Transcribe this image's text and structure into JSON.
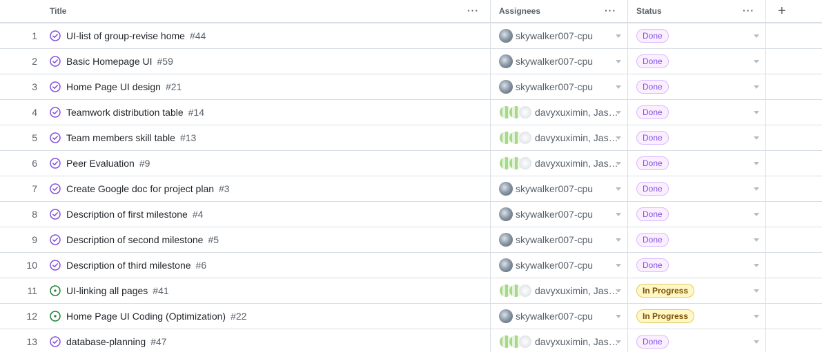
{
  "header": {
    "title": "Title",
    "assignees": "Assignees",
    "status": "Status",
    "menu_dots": "···",
    "add_column": "+"
  },
  "colors": {
    "done_accent": "#8250df",
    "open_accent": "#1a7f37",
    "progress_bg": "#fff8c5"
  },
  "rows": [
    {
      "num": "1",
      "title": "UI-list of group-revise home",
      "issue": "#44",
      "state": "done",
      "assignees": "skywalker007-cpu",
      "avatars": "single",
      "status": "Done"
    },
    {
      "num": "2",
      "title": "Basic Homepage UI",
      "issue": "#59",
      "state": "done",
      "assignees": "skywalker007-cpu",
      "avatars": "single",
      "status": "Done"
    },
    {
      "num": "3",
      "title": "Home Page UI design",
      "issue": "#21",
      "state": "done",
      "assignees": "skywalker007-cpu",
      "avatars": "single",
      "status": "Done"
    },
    {
      "num": "4",
      "title": "Teamwork distribution table",
      "issue": "#14",
      "state": "done",
      "assignees": "davyxuximin, Jases...",
      "avatars": "multi",
      "status": "Done"
    },
    {
      "num": "5",
      "title": "Team members skill table",
      "issue": "#13",
      "state": "done",
      "assignees": "davyxuximin, Jases...",
      "avatars": "multi",
      "status": "Done"
    },
    {
      "num": "6",
      "title": "Peer Evaluation",
      "issue": "#9",
      "state": "done",
      "assignees": "davyxuximin, Jases...",
      "avatars": "multi",
      "status": "Done"
    },
    {
      "num": "7",
      "title": "Create Google doc for project plan",
      "issue": "#3",
      "state": "done",
      "assignees": "skywalker007-cpu",
      "avatars": "single",
      "status": "Done"
    },
    {
      "num": "8",
      "title": "Description of first milestone",
      "issue": "#4",
      "state": "done",
      "assignees": "skywalker007-cpu",
      "avatars": "single",
      "status": "Done"
    },
    {
      "num": "9",
      "title": "Description of second milestone",
      "issue": "#5",
      "state": "done",
      "assignees": "skywalker007-cpu",
      "avatars": "single",
      "status": "Done"
    },
    {
      "num": "10",
      "title": "Description of third milestone",
      "issue": "#6",
      "state": "done",
      "assignees": "skywalker007-cpu",
      "avatars": "single",
      "status": "Done"
    },
    {
      "num": "11",
      "title": "UI-linking all pages",
      "issue": "#41",
      "state": "open",
      "assignees": "davyxuximin, Jases...",
      "avatars": "multi",
      "status": "In Progress"
    },
    {
      "num": "12",
      "title": "Home Page UI Coding (Optimization)",
      "issue": "#22",
      "state": "open",
      "assignees": "skywalker007-cpu",
      "avatars": "single",
      "status": "In Progress"
    },
    {
      "num": "13",
      "title": "database-planning",
      "issue": "#47",
      "state": "done",
      "assignees": "davyxuximin, Jases...",
      "avatars": "multi",
      "status": "Done"
    }
  ]
}
